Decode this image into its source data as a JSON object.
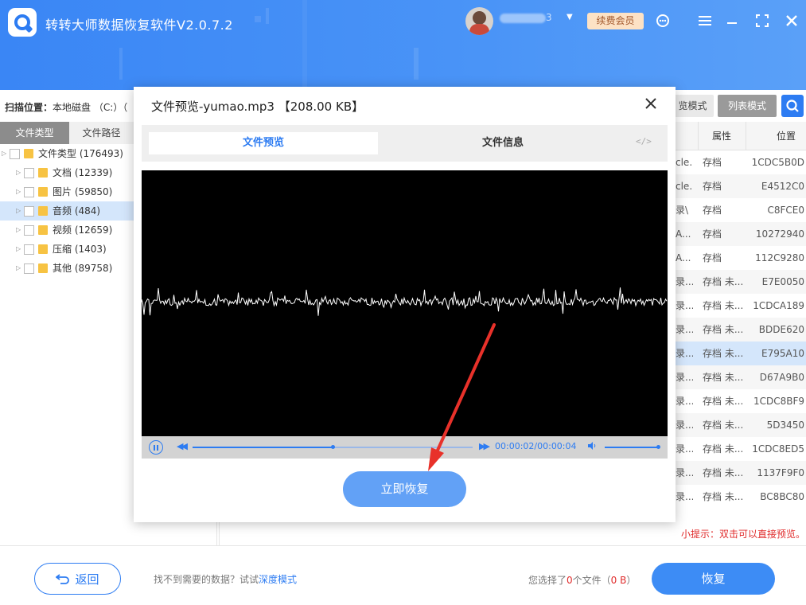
{
  "app": {
    "title": "转转大师数据恢复软件V2.0.7.2",
    "user_name_suffix": "3",
    "vip_label": "续费会员",
    "colors": {
      "accent": "#2d7cf2",
      "header": "#3a86f5",
      "warning": "#e02b2b"
    }
  },
  "toolbar": {
    "scan_label": "扫描位置：",
    "scan_value": "本地磁盘 （C:）（",
    "mode_thumb": "览模式",
    "mode_list": "列表模式"
  },
  "left_panel": {
    "tab_type": "文件类型",
    "tab_path": "文件路径",
    "tree": [
      {
        "label": "文件类型 (176493)",
        "level": 0
      },
      {
        "label": "文档 (12339)",
        "level": 1
      },
      {
        "label": "图片 (59850)",
        "level": 1
      },
      {
        "label": "音频 (484)",
        "level": 1,
        "selected": true
      },
      {
        "label": "视频 (12659)",
        "level": 1
      },
      {
        "label": "压缩 (1403)",
        "level": 1
      },
      {
        "label": "其他 (89758)",
        "level": 1
      }
    ]
  },
  "table": {
    "headers": {
      "attr": "属性",
      "location": "位置"
    },
    "rows": [
      {
        "path": "cle...",
        "attr": "存档",
        "loc": "1CDC5B0D"
      },
      {
        "path": "cle...",
        "attr": "存档",
        "loc": "E4512C0"
      },
      {
        "path": "录\\",
        "attr": "存档",
        "loc": "C8FCE0"
      },
      {
        "path": "A...",
        "attr": "存档",
        "loc": "10272940"
      },
      {
        "path": "A...",
        "attr": "存档",
        "loc": "112C9280"
      },
      {
        "path": "录...",
        "attr": "存档 未...",
        "loc": "E7E0050"
      },
      {
        "path": "录...",
        "attr": "存档 未...",
        "loc": "1CDCA189"
      },
      {
        "path": "录...",
        "attr": "存档 未...",
        "loc": "BDDE620"
      },
      {
        "path": "录...",
        "attr": "存档 未...",
        "loc": "E795A10",
        "selected": true
      },
      {
        "path": "录...",
        "attr": "存档 未...",
        "loc": "D67A9B0"
      },
      {
        "path": "录...",
        "attr": "存档 未...",
        "loc": "1CDC8BF9"
      },
      {
        "path": "录...",
        "attr": "存档 未...",
        "loc": "5D3450"
      },
      {
        "path": "录...",
        "attr": "存档 未...",
        "loc": "1CDC8ED5"
      },
      {
        "path": "录...",
        "attr": "存档 未...",
        "loc": "1137F9F0"
      },
      {
        "path": "录...",
        "attr": "存档 未...",
        "loc": "BC8BC80"
      }
    ],
    "tip": "小提示：双击可以直接预览。"
  },
  "footer": {
    "back_label": "返回",
    "hint_text": "找不到需要的数据？试试",
    "hint_link": "深度模式",
    "sel_prefix": "您选择了",
    "sel_count": "0",
    "sel_mid": "个文件（",
    "sel_size": "0 B",
    "sel_suffix": "）",
    "recover_label": "恢复"
  },
  "modal": {
    "title": "文件预览-yumao.mp3 【208.00 KB】",
    "tab_preview": "文件预览",
    "tab_info": "文件信息",
    "code_icon": "</>",
    "player": {
      "time": "00:00:02/00:00:04",
      "progress_fraction": 0.5
    },
    "restore_label": "立即恢复"
  }
}
